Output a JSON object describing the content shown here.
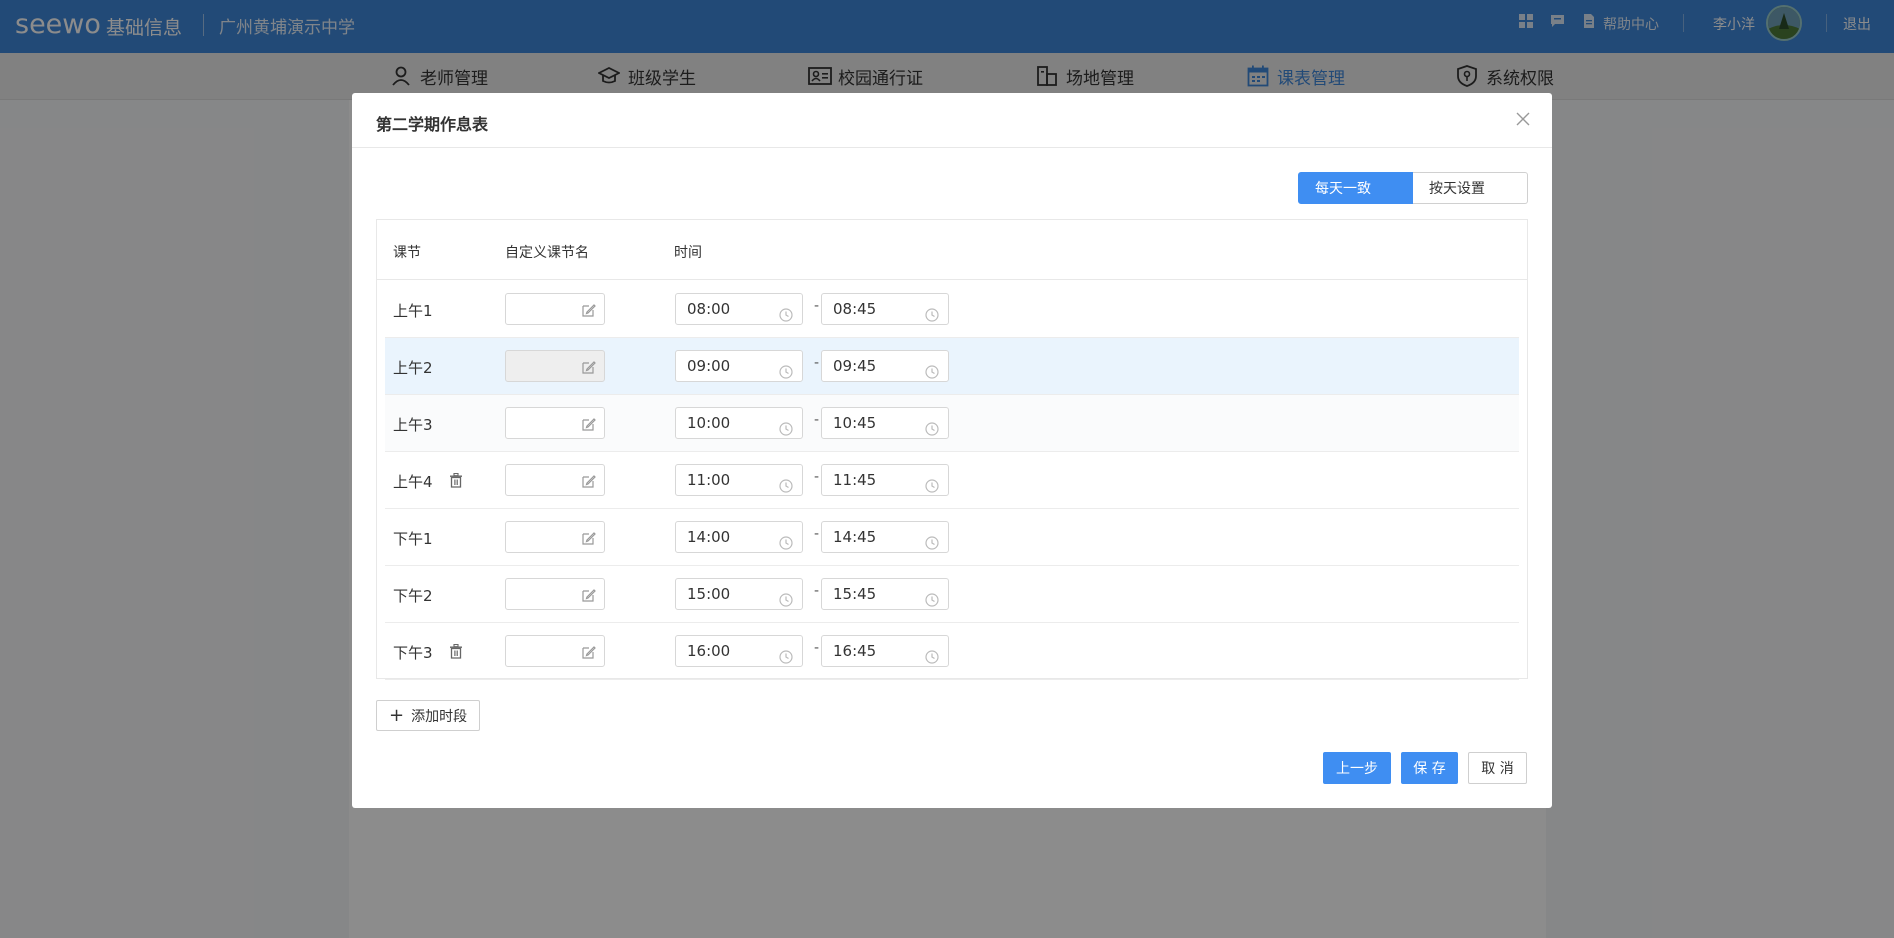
{
  "header": {
    "logo": "seewo",
    "app_name": "基础信息",
    "school": "广州黄埔演示中学",
    "help": "帮助中心",
    "user": "李小洋",
    "logout": "退出"
  },
  "nav": {
    "items": [
      {
        "label": "老师管理",
        "icon": "person-icon",
        "active": false
      },
      {
        "label": "班级学生",
        "icon": "graduation-cap-icon",
        "active": false
      },
      {
        "label": "校园通行证",
        "icon": "id-card-icon",
        "active": false
      },
      {
        "label": "场地管理",
        "icon": "building-icon",
        "active": false
      },
      {
        "label": "课表管理",
        "icon": "calendar-icon",
        "active": true
      },
      {
        "label": "系统权限",
        "icon": "shield-icon",
        "active": false
      }
    ]
  },
  "modal": {
    "title": "第二学期作息表",
    "mode_options": [
      "每天一致",
      "按天设置"
    ],
    "mode_selected": "每天一致",
    "columns": [
      "课节",
      "自定义课节名",
      "时间"
    ],
    "rows": [
      {
        "label": "上午1",
        "start": "08:00",
        "end": "08:45",
        "deletable": false
      },
      {
        "label": "上午2",
        "start": "09:00",
        "end": "09:45",
        "deletable": false
      },
      {
        "label": "上午3",
        "start": "10:00",
        "end": "10:45",
        "deletable": false
      },
      {
        "label": "上午4",
        "start": "11:00",
        "end": "11:45",
        "deletable": true
      },
      {
        "label": "下午1",
        "start": "14:00",
        "end": "14:45",
        "deletable": false
      },
      {
        "label": "下午2",
        "start": "15:00",
        "end": "15:45",
        "deletable": false
      },
      {
        "label": "下午3",
        "start": "16:00",
        "end": "16:45",
        "deletable": true
      }
    ],
    "time_separator": "-",
    "add_label": "添加时段",
    "prev_label": "上一步",
    "save_label": "保 存",
    "cancel_label": "取 消"
  },
  "colors": {
    "brand": "#3f87d9",
    "primary_button": "#3f8ef2",
    "row_hover": "#eaf4fd"
  }
}
